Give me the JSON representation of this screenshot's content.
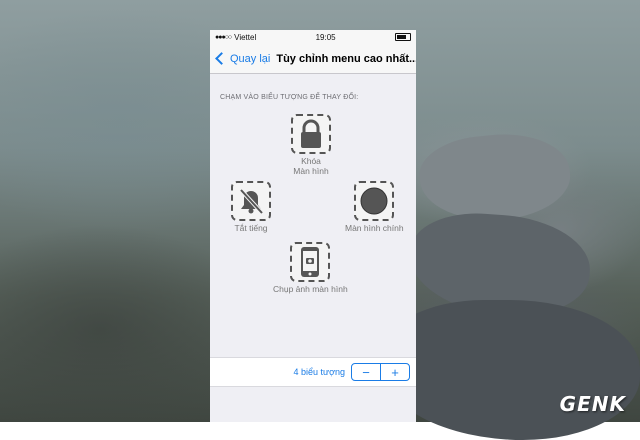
{
  "statusbar": {
    "carrier": "Viettel",
    "time": "19:05"
  },
  "navbar": {
    "back_label": "Quay lại",
    "title": "Tùy chỉnh menu cao nhất..."
  },
  "section_header": "CHẠM VÀO BIỂU TƯỢNG ĐỂ THAY ĐỔI:",
  "icons": [
    {
      "name": "lock-icon",
      "label_line1": "Khóa",
      "label_line2": "Màn hình"
    },
    {
      "name": "mute-icon",
      "label_line1": "Tắt tiếng",
      "label_line2": ""
    },
    {
      "name": "home-icon",
      "label_line1": "Màn hình chính",
      "label_line2": ""
    },
    {
      "name": "screenshot-icon",
      "label_line1": "Chụp ảnh màn hình",
      "label_line2": ""
    }
  ],
  "footer": {
    "count_label": "4 biểu tượng",
    "minus": "−",
    "plus": "+"
  },
  "watermark": "GENK",
  "colors": {
    "accent": "#1a7ce6",
    "background": "#efeff4"
  }
}
